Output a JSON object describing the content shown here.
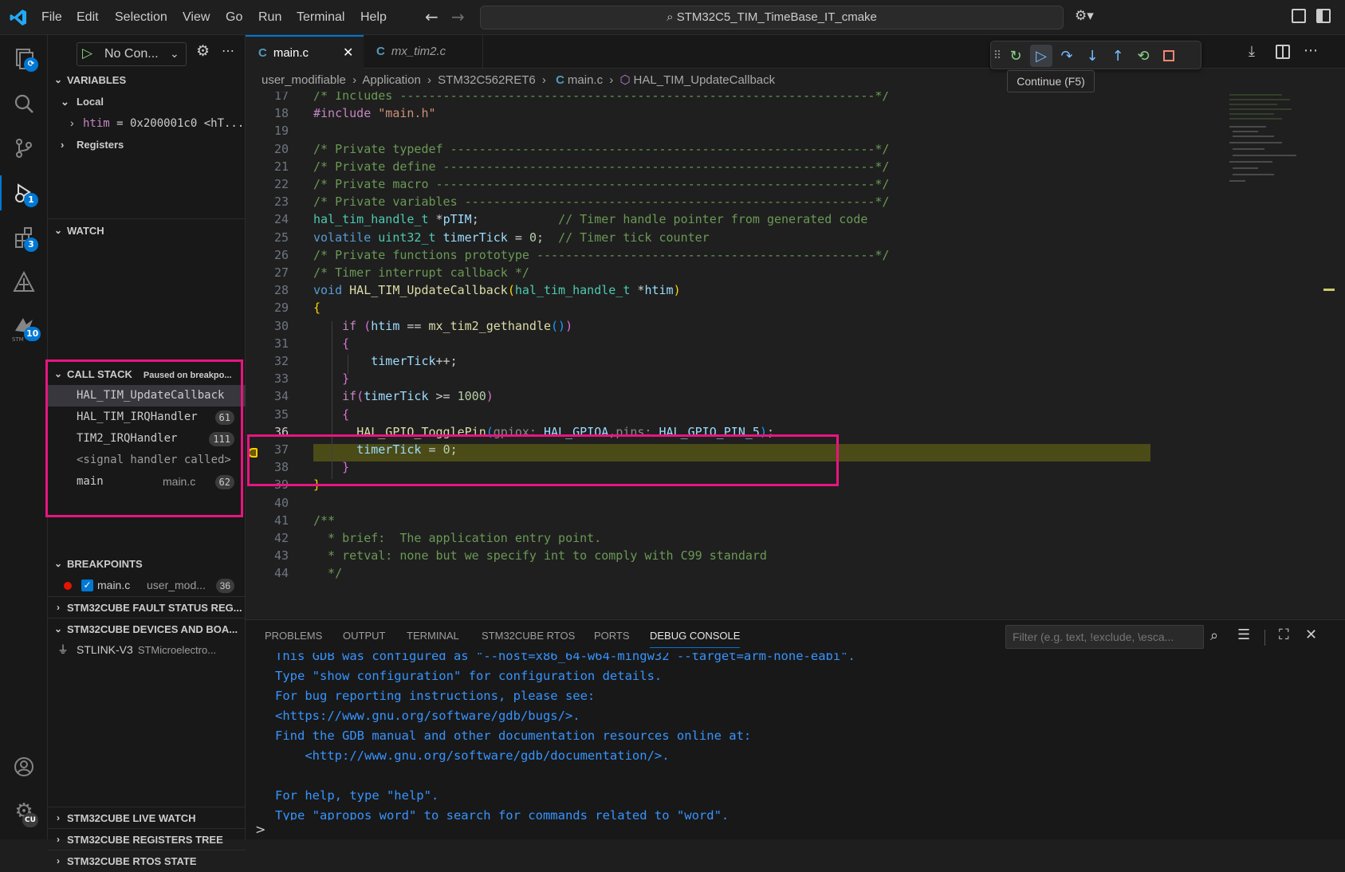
{
  "window": {
    "title": "STM32C5_TIM_TimeBase_IT_cmake"
  },
  "menu": [
    "File",
    "Edit",
    "Selection",
    "View",
    "Go",
    "Run",
    "Terminal",
    "Help"
  ],
  "activity": {
    "explorer_badge": "",
    "debug_badge": "1",
    "extensions_badge": "3",
    "stm_badge": "10",
    "stm_label": "STM",
    "manage_badge": "CU"
  },
  "run_config": {
    "label": "No Con..."
  },
  "variables": {
    "title": "VARIABLES",
    "local": "Local",
    "htim_name": "htim",
    "htim_value": " = 0x200001c0 <hT...",
    "registers": "Registers"
  },
  "watch": {
    "title": "WATCH"
  },
  "callstack": {
    "title": "CALL STACK",
    "status": "Paused on breakpo...",
    "frames": [
      {
        "name": "HAL_TIM_UpdateCallback",
        "file": "",
        "line": ""
      },
      {
        "name": "HAL_TIM_IRQHandler",
        "file": "",
        "line": "61"
      },
      {
        "name": "TIM2_IRQHandler",
        "file": "",
        "line": "111"
      },
      {
        "name": "<signal handler called>",
        "file": "",
        "line": ""
      },
      {
        "name": "main",
        "file": "main.c",
        "line": "62"
      }
    ]
  },
  "breakpoints": {
    "title": "BREAKPOINTS",
    "item": {
      "file": "main.c",
      "path": "user_mod...",
      "line": "36"
    }
  },
  "fault": {
    "title": "STM32CUBE FAULT STATUS REG..."
  },
  "devices": {
    "title": "STM32CUBE DEVICES AND BOA...",
    "item": "STLINK-V3",
    "vendor": "STMicroelectro..."
  },
  "live_watch": {
    "title": "STM32CUBE LIVE WATCH"
  },
  "registers_tree": {
    "title": "STM32CUBE REGISTERS TREE"
  },
  "rtos_state": {
    "title": "STM32CUBE RTOS STATE"
  },
  "tabs": [
    {
      "label": "main.c",
      "icon": "C",
      "active": true
    },
    {
      "label": "mx_tim2.c",
      "icon": "C",
      "active": false
    }
  ],
  "breadcrumb": [
    "user_modifiable",
    "Application",
    "STM32C562RET6",
    "main.c",
    "HAL_TIM_UpdateCallback"
  ],
  "tooltip": "Continue (F5)",
  "code_line_numbers": [
    "17",
    "18",
    "19",
    "20",
    "21",
    "22",
    "23",
    "24",
    "25",
    "26",
    "27",
    "28",
    "29",
    "30",
    "31",
    "32",
    "33",
    "34",
    "35",
    "36",
    "37",
    "38",
    "39",
    "40",
    "41",
    "42",
    "43",
    "44"
  ],
  "current_line": "36",
  "panel": {
    "tabs": [
      "PROBLEMS",
      "OUTPUT",
      "TERMINAL",
      "STM32CUBE RTOS",
      "PORTS",
      "DEBUG CONSOLE"
    ],
    "active_tab": "DEBUG CONSOLE",
    "filter_placeholder": "Filter (e.g. text, !exclude, \\esca...",
    "console_lines": [
      "This GDB was configured as \"--host=x86_64-w64-mingw32 --target=arm-none-eabi\".",
      "Type \"show configuration\" for configuration details.",
      "For bug reporting instructions, please see:",
      "<https://www.gnu.org/software/gdb/bugs/>.",
      "Find the GDB manual and other documentation resources online at:",
      "    <http://www.gnu.org/software/gdb/documentation/>.",
      "",
      "For help, type \"help\".",
      "Type \"apropos word\" to search for commands related to \"word\"."
    ],
    "prompt": ">"
  },
  "colors": {
    "accent": "#0078d4",
    "highlight_box": "#e8157f",
    "current_line_bg": "#4b4b18",
    "breakpoint": "#e51400"
  }
}
